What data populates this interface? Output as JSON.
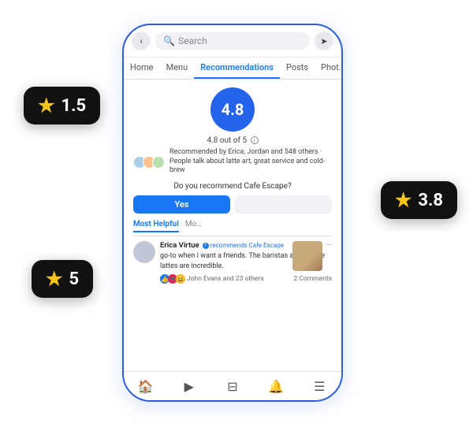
{
  "phone": {
    "topbar": {
      "back_label": "‹",
      "search_placeholder": "Search",
      "share_label": "➤"
    },
    "nav": {
      "items": [
        {
          "label": "Home",
          "active": false
        },
        {
          "label": "Menu",
          "active": false
        },
        {
          "label": "Recommendations",
          "active": true
        },
        {
          "label": "Posts",
          "active": false
        },
        {
          "label": "Phot…",
          "active": false
        }
      ]
    },
    "content": {
      "rating_value": "4.8",
      "rating_subtitle": "4.8 out of 5",
      "info_icon": "i",
      "recommenders_text": "Recommended by Erica, Jordan and 548 others · People talk about latte art, great service and cold-brew",
      "recommend_question": "Do you recommend Cafe Escape?",
      "btn_yes": "Yes",
      "btn_no": "",
      "filter_tabs": [
        {
          "label": "Most Helpful",
          "active": true
        },
        {
          "label": "Mo…",
          "active": false
        }
      ],
      "review": {
        "reviewer_name": "Erica Virtue",
        "badge_text": "recommends Cafe Escape",
        "more_icon": "···",
        "text": "go-to when I want a friends. The baristas are and the lattes are incredible.",
        "reactions_text": "John Evans and 23 others",
        "comments_text": "2 Comments"
      }
    },
    "bottom_nav": {
      "icons": [
        "🏠",
        "▶",
        "⊟",
        "🔔",
        "☰"
      ]
    }
  },
  "badges": {
    "badge1": {
      "value": "1.5",
      "star": "★"
    },
    "badge2": {
      "value": "3.8",
      "star": "★"
    },
    "badge3": {
      "value": "5",
      "star": "★"
    }
  }
}
